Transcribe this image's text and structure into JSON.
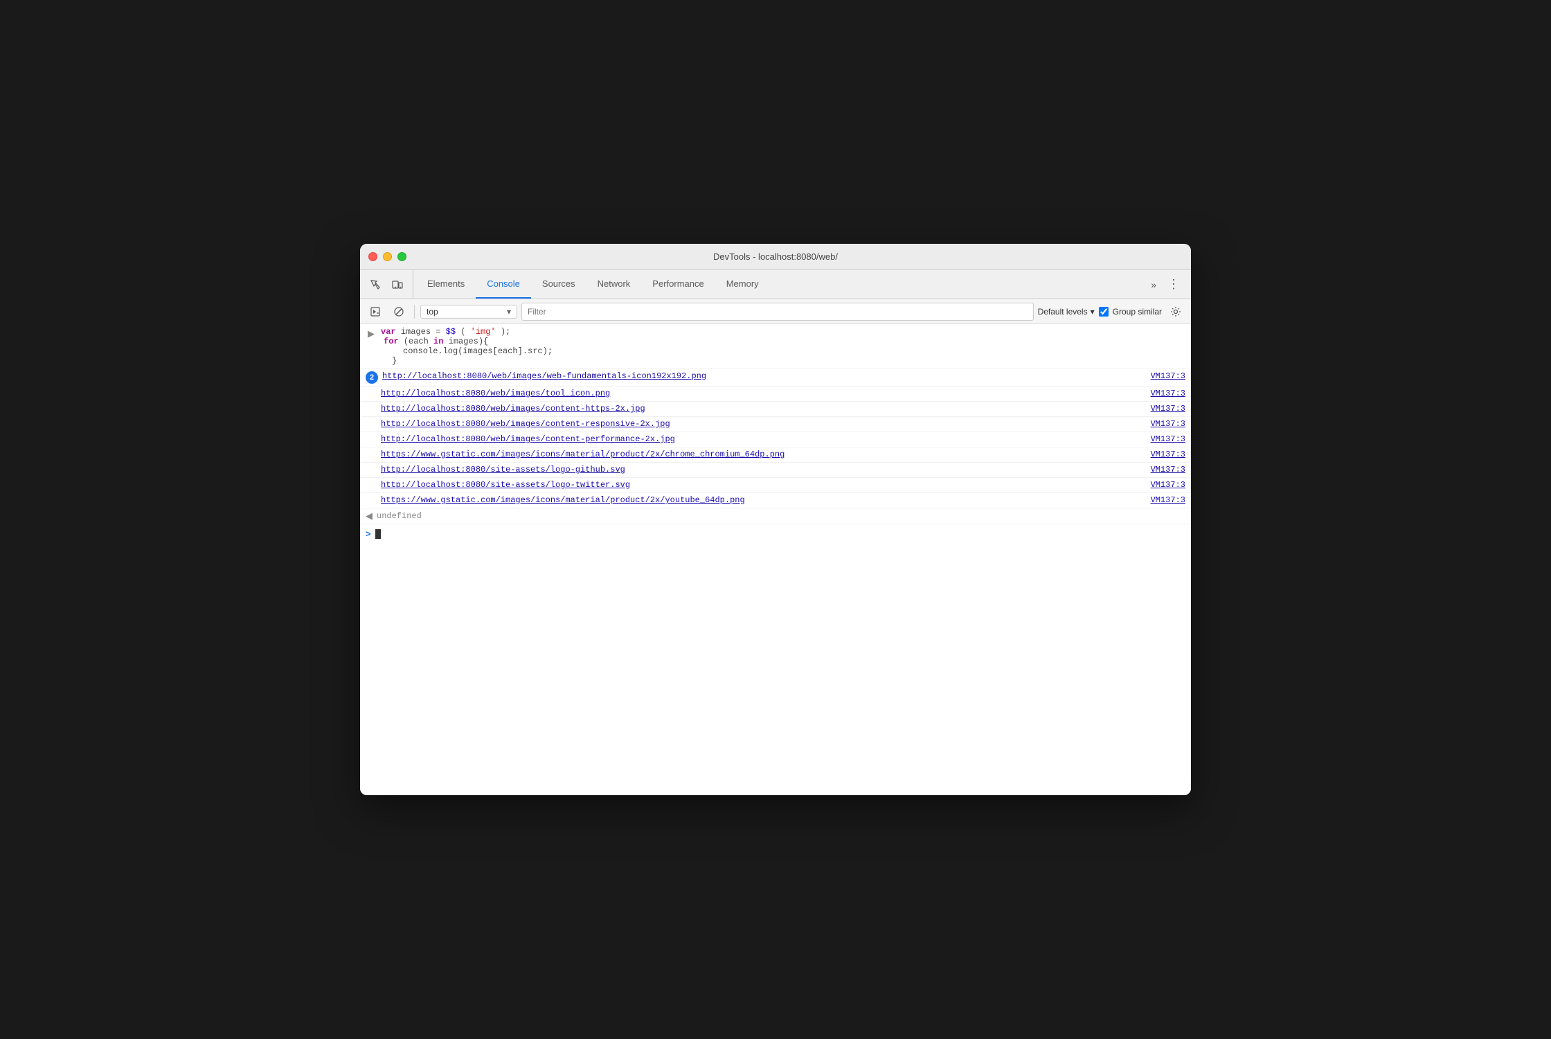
{
  "window": {
    "title": "DevTools - localhost:8080/web/"
  },
  "tabs": [
    {
      "id": "elements",
      "label": "Elements",
      "active": false
    },
    {
      "id": "console",
      "label": "Console",
      "active": true
    },
    {
      "id": "sources",
      "label": "Sources",
      "active": false
    },
    {
      "id": "network",
      "label": "Network",
      "active": false
    },
    {
      "id": "performance",
      "label": "Performance",
      "active": false
    },
    {
      "id": "memory",
      "label": "Memory",
      "active": false
    }
  ],
  "toolbar": {
    "context": "top",
    "filter_placeholder": "Filter",
    "default_levels": "Default levels",
    "group_similar": "Group similar",
    "chevron_down": "▾"
  },
  "console": {
    "code": {
      "line1": "var images = $$('img');",
      "line2": "for (each in images){",
      "line3": "        console.log(images[each].src);",
      "line4": "    }"
    },
    "badge_count": "2",
    "log_entries": [
      {
        "url": "http://localhost:8080/web/images/web-fundamentals-icon192x192.png",
        "source": "VM137:3"
      },
      {
        "url": "http://localhost:8080/web/images/tool_icon.png",
        "source": "VM137:3"
      },
      {
        "url": "http://localhost:8080/web/images/content-https-2x.jpg",
        "source": "VM137:3"
      },
      {
        "url": "http://localhost:8080/web/images/content-responsive-2x.jpg",
        "source": "VM137:3"
      },
      {
        "url": "http://localhost:8080/web/images/content-performance-2x.jpg",
        "source": "VM137:3"
      },
      {
        "url": "https://www.gstatic.com/images/icons/material/product/2x/chrome_chromium_64dp.png",
        "source": "VM137:3"
      },
      {
        "url": "http://localhost:8080/site-assets/logo-github.svg",
        "source": "VM137:3"
      },
      {
        "url": "http://localhost:8080/site-assets/logo-twitter.svg",
        "source": "VM137:3"
      },
      {
        "url": "https://www.gstatic.com/images/icons/material/product/2x/youtube_64dp.png",
        "source": "VM137:3"
      }
    ],
    "undefined_text": "undefined",
    "prompt_symbol": ">"
  },
  "colors": {
    "accent": "#1a73e8",
    "active_tab": "#1a73e8",
    "link": "#1a0dab",
    "keyword": "#aa0d91",
    "string": "#c41a16"
  }
}
